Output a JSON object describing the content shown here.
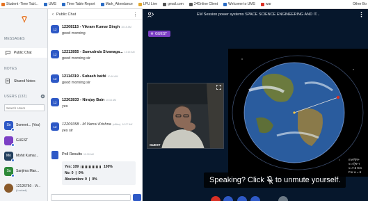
{
  "browser": {
    "bookmarks": [
      {
        "label": "Student -Time Tabl...",
        "icon_color": "#e57322"
      },
      {
        "label": "UMS",
        "icon_color": "#2b6cc4"
      },
      {
        "label": "Time Table Report",
        "icon_color": "#2b6cc4"
      },
      {
        "label": "Mark_Attendance",
        "icon_color": "#2b6cc4"
      },
      {
        "label": "LPU Live",
        "icon_color": "#e2a62b"
      },
      {
        "label": "gmail.com",
        "icon_color": "#555555"
      },
      {
        "label": "24Online Client",
        "icon_color": "#555555"
      },
      {
        "label": "Welcome to UMS",
        "icon_color": "#2b6cc4"
      },
      {
        "label": "war",
        "icon_color": "#d93025"
      }
    ],
    "other_bookmarks": "Other Bo"
  },
  "sidebar": {
    "messages_heading": "MESSAGES",
    "public_chat_label": "Public Chat",
    "notes_heading": "NOTES",
    "shared_notes_label": "Shared Notes",
    "users_heading": "USERS (132)",
    "search_placeholder": "Search Users",
    "users": [
      {
        "initials": "So",
        "name": "Someet... (You)",
        "color": "#2e59c6"
      },
      {
        "initials": "",
        "name": "GUEST",
        "color": "#7b3fc4"
      },
      {
        "initials": "Mo",
        "name": "Mohit Kumar...",
        "color": "#23405e"
      },
      {
        "initials": "Sa",
        "name": "Sanjima Man...",
        "color": "#2e8a3a"
      },
      {
        "initials": "",
        "name": "12126750 - Vi...",
        "sub": "(Locked)",
        "color": "#8a5a2b"
      }
    ]
  },
  "chat": {
    "title": "Public Chat",
    "messages": [
      {
        "initials": "12",
        "name": "12208115 - Vikram Kumar Singh",
        "time": "10:15 AM",
        "text": "good morning"
      },
      {
        "initials": "12",
        "name": "12212855 - Samudrala Sivanaga...",
        "time": "10:15 AM",
        "text": "good morning sir"
      },
      {
        "initials": "12",
        "name": "12114319 - Subash bathi",
        "time": "10:16 AM",
        "text": "good morning sir"
      },
      {
        "initials": "12",
        "name": "12202833 - Nirajay Bain",
        "time": "10:16 AM",
        "text": "yes"
      },
      {
        "initials": "12",
        "name": "12209358 - M Vamsi Krishna",
        "time": "10:27 AM",
        "offline": "(offline)",
        "text": "yes sir"
      }
    ],
    "poll": {
      "title": "Poll Results",
      "time": "10:30 AM",
      "rows": [
        {
          "label": "Yes: 109",
          "percent": "100%",
          "fraction": 1.0
        },
        {
          "label": "No: 0",
          "percent": "0%",
          "fraction": 0
        },
        {
          "label": "Abstention: 0",
          "percent": "0%",
          "fraction": 0
        }
      ]
    }
  },
  "presentation": {
    "title": "EM Session power systems SPACE SCIENCE ENGINEERING AND IT...",
    "badge": "GUEST",
    "camera_label": "GUEST",
    "screen_text": [
      "mv²/(R+",
      "v=√(R+r",
      "v=7.5 Km",
      "For a = 6"
    ],
    "speaking_banner_prefix": "Speaking? Click",
    "speaking_banner_suffix": "to unmute yourself."
  },
  "colors": {
    "accent": "#2e59c6",
    "guest": "#7b3fc4",
    "bg_dark": "#06172c"
  }
}
